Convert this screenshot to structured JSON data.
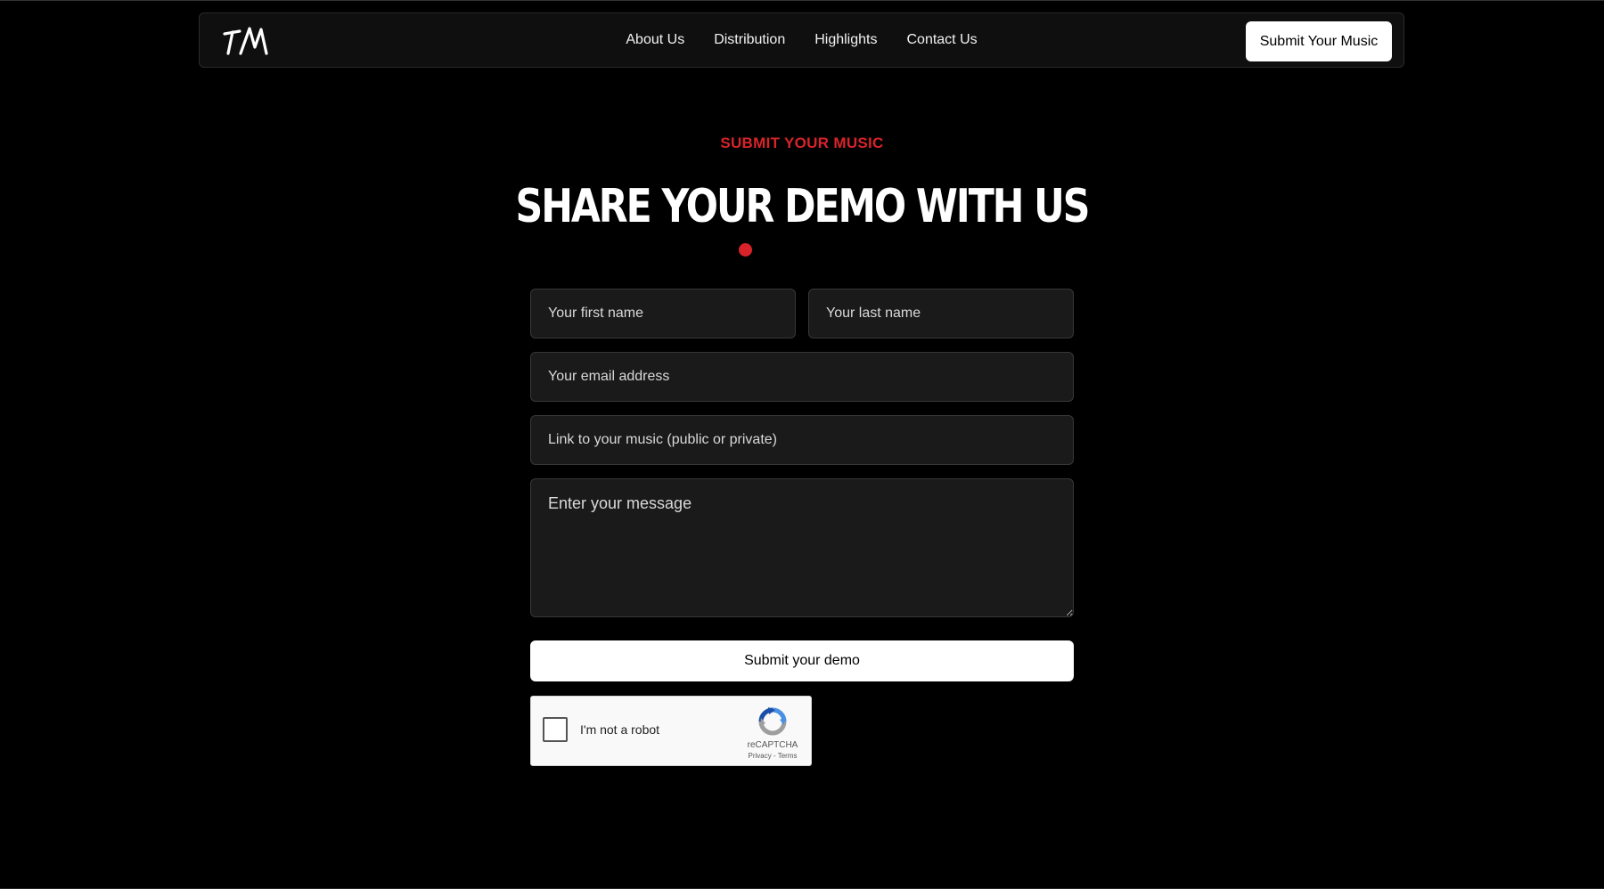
{
  "nav": {
    "logo_text": "TM",
    "links": [
      "About Us",
      "Distribution",
      "Highlights",
      "Contact Us"
    ],
    "cta_label": "Submit Your Music"
  },
  "header": {
    "eyebrow": "SUBMIT YOUR MUSIC",
    "title": "SHARE YOUR DEMO WITH US"
  },
  "form": {
    "first_name_placeholder": "Your first name",
    "last_name_placeholder": "Your last name",
    "email_placeholder": "Your email address",
    "music_link_placeholder": "Link to your music (public or private)",
    "message_placeholder": "Enter your message",
    "submit_label": "Submit your demo"
  },
  "recaptcha": {
    "label": "I'm not a robot",
    "brand": "reCAPTCHA",
    "privacy": "Privacy",
    "separator": " - ",
    "terms": "Terms"
  },
  "colors": {
    "accent": "#d8232a",
    "background": "#000000",
    "field_bg": "#1a1a1a",
    "button_bg": "#ffffff"
  }
}
